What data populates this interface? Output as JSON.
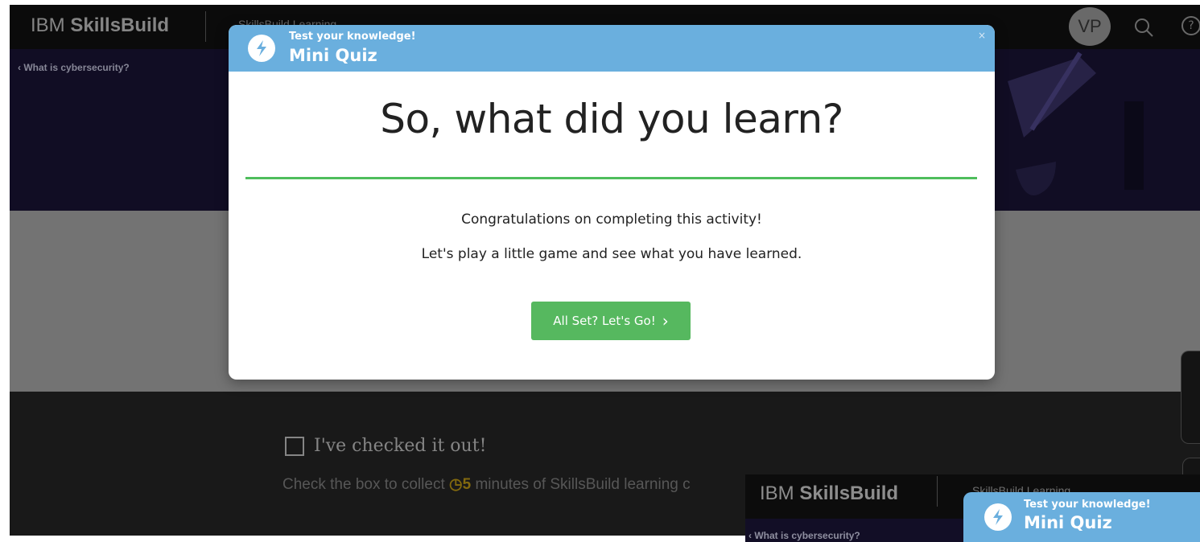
{
  "app": {
    "brand_prefix": "IBM",
    "brand_name": "SkillsBuild",
    "section_title": "SkillsBuild Learning",
    "avatar_initials": "VP",
    "breadcrumb": "What is cybersecurity?"
  },
  "modal": {
    "subtitle": "Test your knowledge!",
    "title": "Mini Quiz",
    "close_label": "×",
    "heading": "So, what did you learn?",
    "message1": "Congratulations on completing this activity!",
    "message2": "Let's play a little game and see what you have learned.",
    "button_label": "All Set? Let's Go!",
    "button_chevron": "›"
  },
  "completion": {
    "checkbox_label": "I've checked it out!",
    "help_prefix": "Check the box to collect",
    "minutes": "5",
    "help_suffix": "minutes of SkillsBuild learning c"
  },
  "colors": {
    "header_blue": "#6aafde",
    "accent_green": "#56b85f",
    "rule_green": "#4fbe5c"
  },
  "icons": [
    "bolt-icon",
    "search-icon",
    "help-icon",
    "close-icon",
    "chevron-left-icon",
    "chevron-right-icon",
    "clock-icon"
  ]
}
